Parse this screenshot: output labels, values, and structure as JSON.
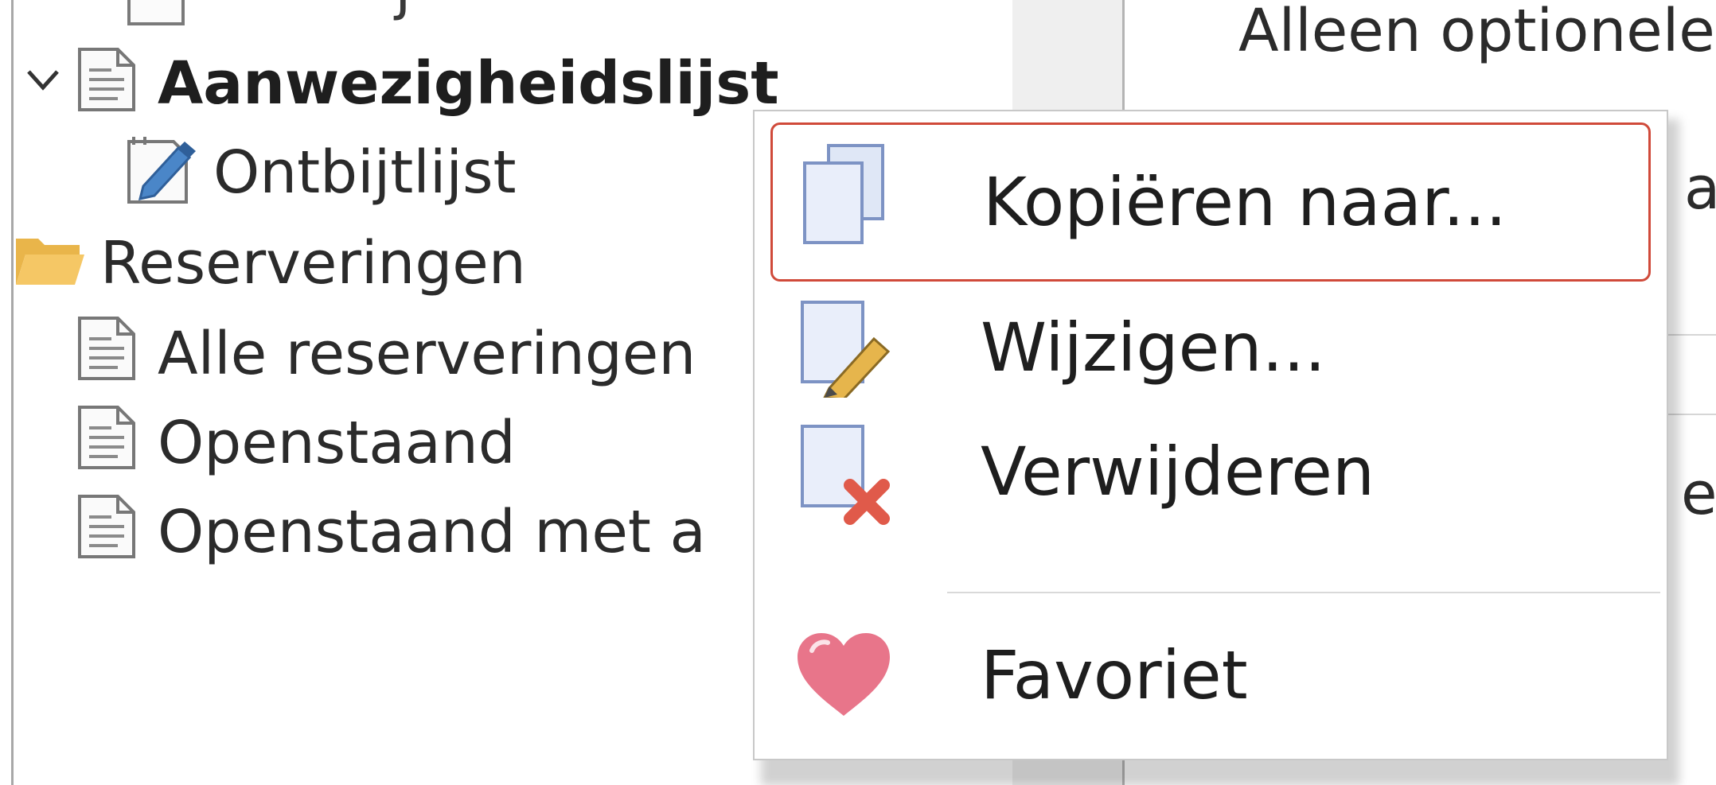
{
  "tree": {
    "items": [
      {
        "label": "Aanwezigheidslijst",
        "icon": "document-icon",
        "expanded": true
      },
      {
        "label": "Ontbijtlijst",
        "icon": "edit-document-icon"
      },
      {
        "label": "Reserveringen",
        "icon": "folder-icon"
      },
      {
        "label": "Alle reserveringen",
        "icon": "document-icon"
      },
      {
        "label": "Openstaand",
        "icon": "document-icon"
      },
      {
        "label": "Openstaand met a",
        "icon": "document-icon"
      }
    ]
  },
  "right_panel": {
    "top_text": "Alleen optionele",
    "partial_texts": [
      "a",
      "e"
    ]
  },
  "context_menu": {
    "items": [
      {
        "label": "Kopiëren naar...",
        "icon": "copy-icon",
        "highlighted": true
      },
      {
        "label": "Wijzigen...",
        "icon": "edit-icon"
      },
      {
        "label": "Verwijderen",
        "icon": "delete-icon"
      },
      {
        "label": "Favoriet",
        "icon": "heart-icon"
      }
    ]
  },
  "colors": {
    "highlight_border": "#d04a3a",
    "folder": "#f5c765",
    "heart": "#e8758a",
    "delete_x": "#e05a4a"
  }
}
